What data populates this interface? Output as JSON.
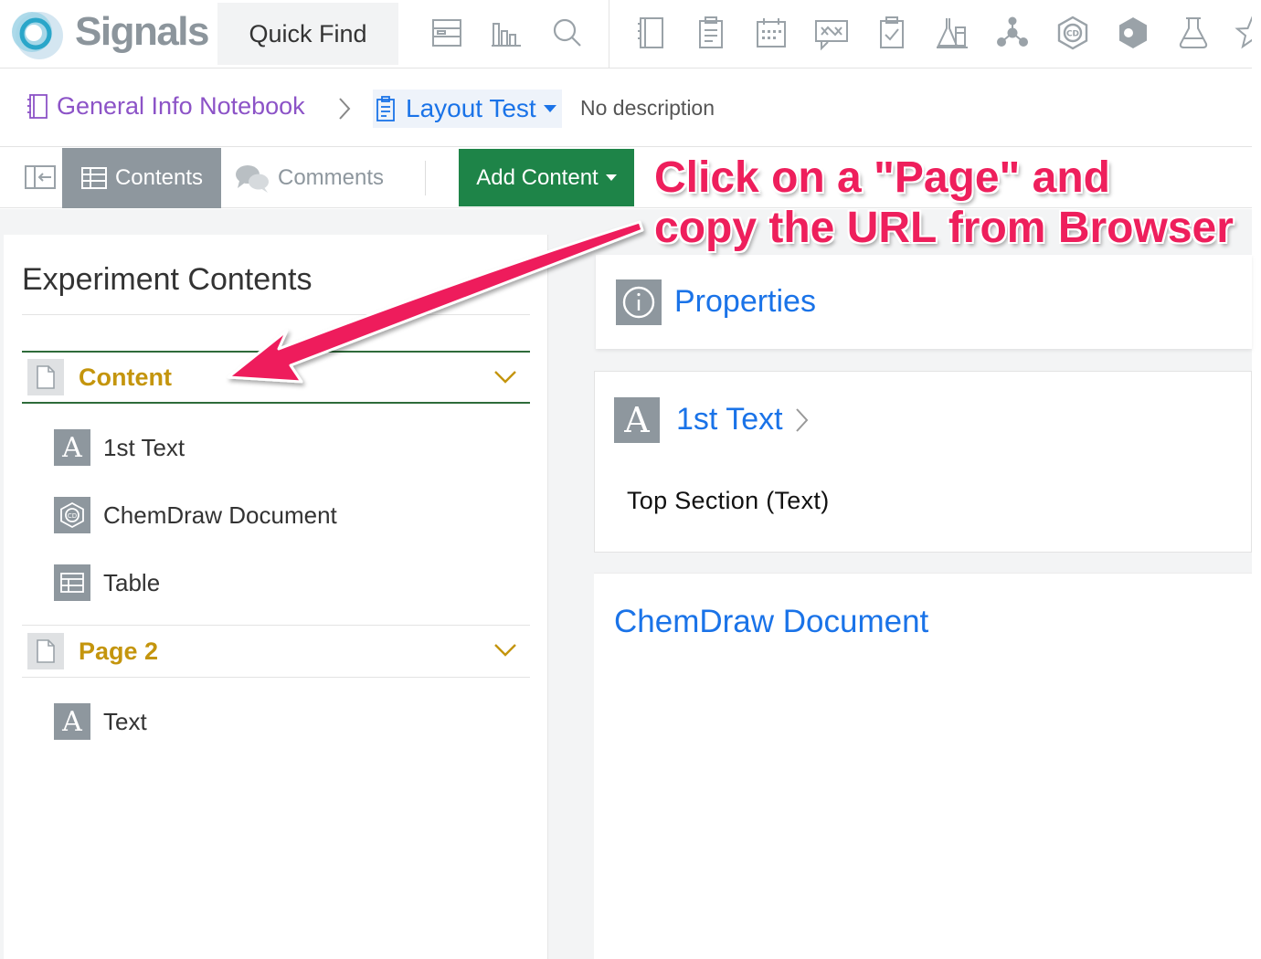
{
  "app": {
    "logo_text": "Signals",
    "quick_find_label": "Quick Find"
  },
  "toolbar_icons": [
    "dashboard-icon",
    "bar-chart-icon",
    "search-icon",
    "notebook-icon",
    "clipboard-icon",
    "calendar-icon",
    "workflow-icon",
    "checklist-icon",
    "lab-equipment-icon",
    "molecule-icon",
    "chemdraw-icon",
    "hexagon-icon",
    "flask-icon",
    "star-icon"
  ],
  "breadcrumb": {
    "notebook": "General Info Notebook",
    "experiment": "Layout Test",
    "description": "No description"
  },
  "tabs": {
    "contents": "Contents",
    "comments": "Comments",
    "add_content": "Add Content"
  },
  "left_panel": {
    "title": "Experiment Contents",
    "pages": [
      {
        "label": "Content",
        "items": [
          "1st Text",
          "ChemDraw Document",
          "Table"
        ]
      },
      {
        "label": "Page 2",
        "items": [
          "Text"
        ]
      }
    ]
  },
  "cards": {
    "properties_title": "Properties",
    "text_title": "1st Text",
    "text_body": "Top Section (Text)",
    "chem_title": "ChemDraw Document"
  },
  "annotation": {
    "line1": "Click on a \"Page\" and",
    "line2": "copy the URL from Browser"
  },
  "colors": {
    "accent_blue": "#1a73e8",
    "notebook_purple": "#8c53c7",
    "page_gold": "#c4950d",
    "add_green": "#1e8448",
    "annotation_pink": "#ee1f5c",
    "icon_grey": "#8e979e"
  }
}
